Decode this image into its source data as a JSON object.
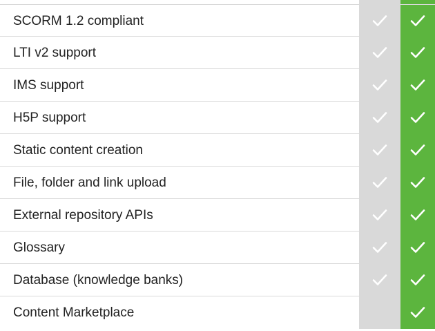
{
  "features": [
    {
      "label": "SCORM 1.2 compliant",
      "col_a": true,
      "col_b": true
    },
    {
      "label": "LTI v2 support",
      "col_a": true,
      "col_b": true
    },
    {
      "label": "IMS support",
      "col_a": true,
      "col_b": true
    },
    {
      "label": "H5P support",
      "col_a": true,
      "col_b": true
    },
    {
      "label": "Static content creation",
      "col_a": true,
      "col_b": true
    },
    {
      "label": "File, folder and link upload",
      "col_a": true,
      "col_b": true
    },
    {
      "label": "External repository APIs",
      "col_a": true,
      "col_b": true
    },
    {
      "label": "Glossary",
      "col_a": true,
      "col_b": true
    },
    {
      "label": "Database (knowledge banks)",
      "col_a": true,
      "col_b": true
    },
    {
      "label": "Content Marketplace",
      "col_a": false,
      "col_b": true
    }
  ],
  "colors": {
    "col_a_bg": "#d9d9d9",
    "col_b_bg": "#5cb53e",
    "check": "#ffffff"
  },
  "icons": {
    "check": "check-icon"
  }
}
